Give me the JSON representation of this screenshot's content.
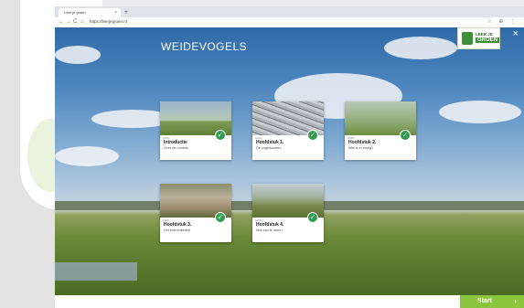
{
  "browser": {
    "tab_title": "Leer je groen",
    "tab_close": "×",
    "new_tab": "+",
    "back": "←",
    "forward": "→",
    "reload": "C",
    "home": "⌂",
    "url": "https://leerjegroen.nl",
    "right_icons": "☆ ⊕ ⋮"
  },
  "page": {
    "title": "WEIDEVOGELS",
    "close": "×",
    "logo_top": "LEER JE",
    "logo_bottom": "GROEN"
  },
  "cards": [
    {
      "title": "Introductie",
      "subtitle": "Over de module",
      "progress": "100%",
      "completed": true
    },
    {
      "title": "Hoofdstuk 1.",
      "subtitle": "De vogelsoorten",
      "progress": "100%",
      "completed": true
    },
    {
      "title": "Hoofdstuk 2.",
      "subtitle": "Wat is er nodig?",
      "progress": "100%",
      "completed": true
    },
    {
      "title": "Hoofdstuk 3.",
      "subtitle": "Het boerenbedrijf",
      "progress": "100%",
      "completed": true
    },
    {
      "title": "Hoofdstuk 4.",
      "subtitle": "Wat kan ik doen?",
      "progress": "100%",
      "completed": true
    }
  ],
  "footer": {
    "start_label": "Start",
    "start_arrow": "›"
  },
  "colors": {
    "accent": "#8cc63f",
    "check": "#2e9b4f"
  }
}
